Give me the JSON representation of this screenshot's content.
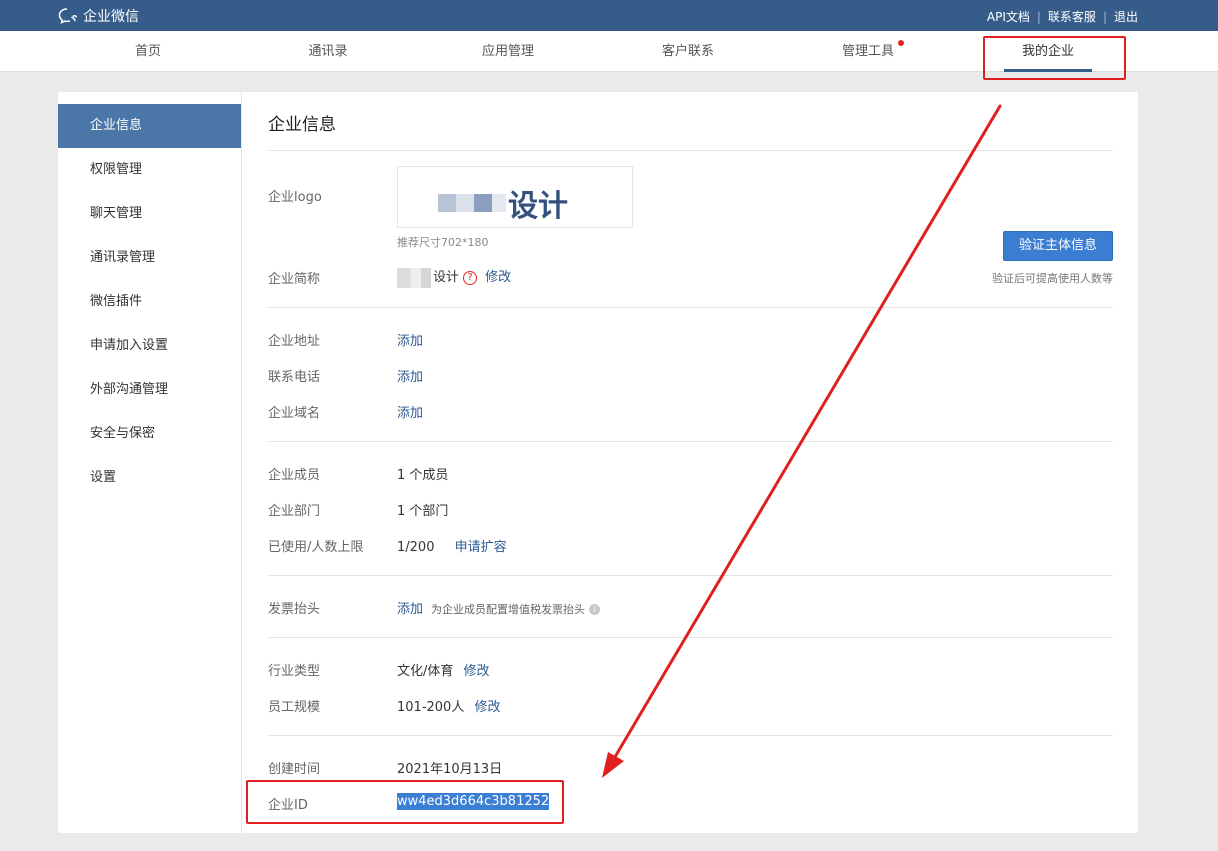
{
  "topbar": {
    "brand": "企业微信",
    "links": [
      "API文档",
      "联系客服",
      "退出"
    ]
  },
  "nav": {
    "items": [
      "首页",
      "通讯录",
      "应用管理",
      "客户联系",
      "管理工具",
      "我的企业"
    ],
    "active": "我的企业"
  },
  "sidebar": {
    "items": [
      "企业信息",
      "权限管理",
      "聊天管理",
      "通讯录管理",
      "微信插件",
      "申请加入设置",
      "外部沟通管理",
      "安全与保密",
      "设置"
    ],
    "active": "企业信息"
  },
  "content": {
    "title": "企业信息",
    "logo_label": "企业logo",
    "logo_text": "设计",
    "logo_hint": "推荐尺寸702*180",
    "verify_button": "验证主体信息",
    "verify_tip": "验证后可提高使用人数等",
    "short_name_label": "企业简称",
    "short_name_value": "设计",
    "short_name_edit": "修改",
    "address_label": "企业地址",
    "address_action": "添加",
    "phone_label": "联系电话",
    "phone_action": "添加",
    "domain_label": "企业域名",
    "domain_action": "添加",
    "members_label": "企业成员",
    "members_value": "1 个成员",
    "departments_label": "企业部门",
    "departments_value": "1 个部门",
    "usage_label": "已使用/人数上限",
    "usage_value": "1/200",
    "usage_action": "申请扩容",
    "invoice_label": "发票抬头",
    "invoice_action": "添加",
    "invoice_tip": "为企业成员配置增值税发票抬头",
    "industry_label": "行业类型",
    "industry_value": "文化/体育",
    "industry_edit": "修改",
    "scale_label": "员工规模",
    "scale_value": "101-200人",
    "scale_edit": "修改",
    "created_label": "创建时间",
    "created_value": "2021年10月13日",
    "corp_id_label": "企业ID",
    "corp_id_value": "ww4ed3d664c3b81252"
  },
  "colors": {
    "topbar": "#365d8a",
    "accent": "#4b76a8",
    "annotation": "#e02020"
  }
}
